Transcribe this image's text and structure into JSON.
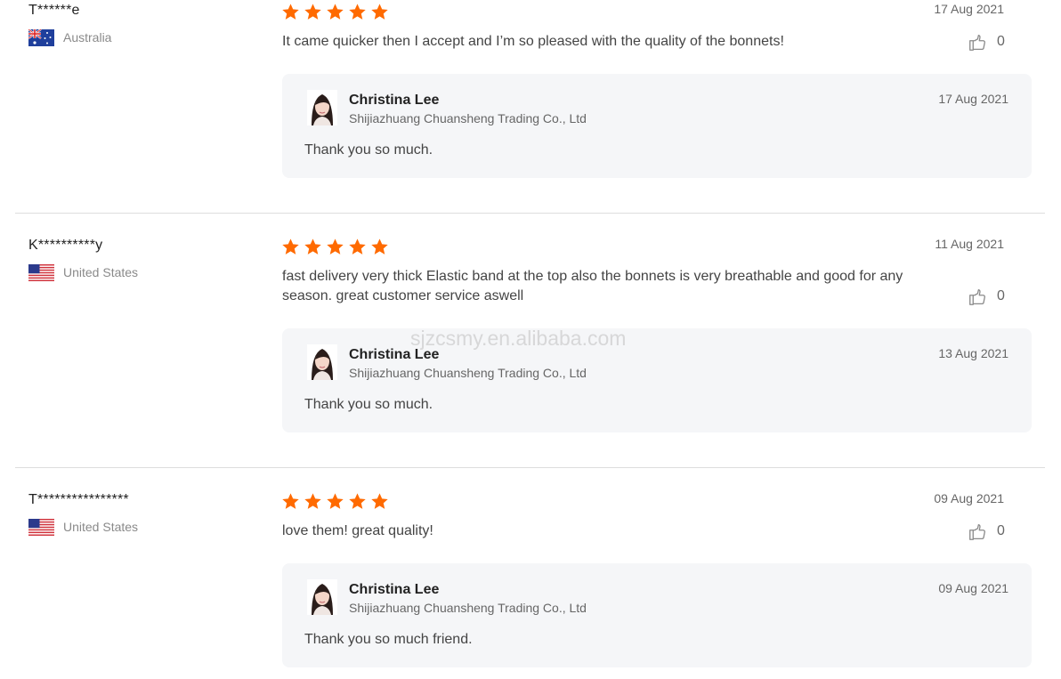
{
  "reviews": [
    {
      "reviewer": "T******e",
      "country": "Australia",
      "flag": "flag-australia",
      "rating": 5,
      "date": "17 Aug 2021",
      "text": "It came quicker then I accept and I’m so pleased with the quality of the bonnets!",
      "likes": "0",
      "reply": {
        "name": "Christina Lee",
        "company": "Shijiazhuang Chuansheng Trading Co., Ltd",
        "date": "17 Aug 2021",
        "text": "Thank you so much."
      }
    },
    {
      "reviewer": "K**********y",
      "country": "United States",
      "flag": "flag-united-states",
      "rating": 5,
      "date": "11 Aug 2021",
      "text": "fast delivery very thick Elastic band at the top also the bonnets is very breathable and good for any season. great customer service aswell",
      "likes": "0",
      "reply": {
        "name": "Christina Lee",
        "company": "Shijiazhuang Chuansheng Trading Co., Ltd",
        "date": "13 Aug 2021",
        "text": "Thank you so much."
      }
    },
    {
      "reviewer": "T****************",
      "country": "United States",
      "flag": "flag-united-states",
      "rating": 5,
      "date": "09 Aug 2021",
      "text": "love them! great quality!",
      "likes": "0",
      "reply": {
        "name": "Christina Lee",
        "company": "Shijiazhuang Chuansheng Trading Co., Ltd",
        "date": "09 Aug 2021",
        "text": "Thank you so much friend."
      }
    }
  ],
  "watermark": "sjzcsmy.en.alibaba.com",
  "colors": {
    "star": "#ff6a00",
    "text": "#444444",
    "muted": "#8a8a8a",
    "reply_bg": "#f5f6f8",
    "divider": "#dddddd"
  },
  "icons": {
    "star": "star-icon",
    "like": "thumbs-up-icon",
    "avatar": "seller-avatar"
  }
}
